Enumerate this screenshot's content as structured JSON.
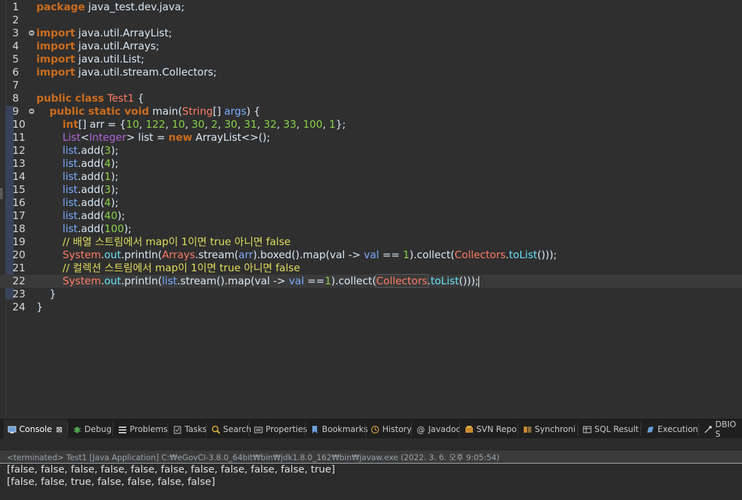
{
  "editor": {
    "lines": [
      {
        "n": "1",
        "html": "<span class=\"kw\">package</span> java_test.dev.java;"
      },
      {
        "n": "2",
        "html": ""
      },
      {
        "n": "3",
        "fold": true,
        "html": "<span class=\"kw\">import</span> java.util.ArrayList;"
      },
      {
        "n": "4",
        "html": "<span class=\"kw\">import</span> java.util.Arrays;"
      },
      {
        "n": "5",
        "html": "<span class=\"kw\">import</span> java.util.List;"
      },
      {
        "n": "6",
        "html": "<span class=\"kw\">import</span> java.util.stream.Collectors;"
      },
      {
        "n": "7",
        "html": ""
      },
      {
        "n": "8",
        "html": "<span class=\"kw\">public class</span> <span class=\"cls\">Test1</span> {"
      },
      {
        "n": "9",
        "fold": true,
        "html": "    <span class=\"kw\">public static void</span> main(<span class=\"cls\">String</span>[] <span class=\"var\">args</span>) {"
      },
      {
        "n": "10",
        "html": "        <span class=\"kw\">int</span>[] arr = {<span class=\"green\">10</span>, <span class=\"green\">122</span>, <span class=\"green\">10</span>, <span class=\"green\">30</span>, <span class=\"green\">2</span>, <span class=\"green\">30</span>, <span class=\"green\">31</span>, <span class=\"green\">32</span>, <span class=\"green\">33</span>, <span class=\"green\">100</span>, <span class=\"green\">1</span>};"
      },
      {
        "n": "11",
        "html": "        <span class=\"type\">List</span>&lt;<span class=\"type\">Integer</span>&gt; list = <span class=\"kw\">new</span> ArrayList&lt;&gt;();"
      },
      {
        "n": "12",
        "html": "        <span class=\"var\">list</span>.add(<span class=\"green\">3</span>);"
      },
      {
        "n": "13",
        "html": "        <span class=\"var\">list</span>.add(<span class=\"green\">4</span>);"
      },
      {
        "n": "14",
        "html": "        <span class=\"var\">list</span>.add(<span class=\"green\">1</span>);"
      },
      {
        "n": "15",
        "html": "        <span class=\"var\">list</span>.add(<span class=\"green\">3</span>);"
      },
      {
        "n": "16",
        "html": "        <span class=\"var\">list</span>.add(<span class=\"green\">4</span>);"
      },
      {
        "n": "17",
        "html": "        <span class=\"var\">list</span>.add(<span class=\"green\">40</span>);"
      },
      {
        "n": "18",
        "html": "        <span class=\"var\">list</span>.add(<span class=\"green\">100</span>);"
      },
      {
        "n": "19",
        "html": "        <span class=\"cmt\">// 배열 스트림에서 map이 1이면 true 아니면 false</span>"
      },
      {
        "n": "20",
        "html": "        <span class=\"cls\">System</span>.<span class=\"field\">out</span>.println(<span class=\"cls\">Arrays</span>.stream(<span class=\"var\">arr</span>).boxed().map(val -&gt; <span class=\"var\">val</span> == <span class=\"green\">1</span>).collect(<span class=\"cls\">Collectors</span>.<span class=\"field\">toList</span>()));"
      },
      {
        "n": "21",
        "html": "        <span class=\"cmt\">// 컬렉션 스트림에서 map이 1이면 true 아니면 false</span>"
      },
      {
        "n": "22",
        "current": true,
        "html": "        <span class=\"cls\">System</span>.<span class=\"field\">out</span>.println(<span class=\"var\">list</span>.stream().map(val -&gt; <span class=\"var\">val</span> ==<span class=\"green\">1</span>).collect(<span class=\"boxhl\"><span class=\"cls\">Collectors</span></span>.<span class=\"field\">toList</span>()));<span id=\"caret\"></span>"
      },
      {
        "n": "23",
        "html": "    }"
      },
      {
        "n": "24",
        "html": "}"
      }
    ]
  },
  "tabs": [
    {
      "label": "Console",
      "icon": "console-icon",
      "active": true,
      "close": "⊠"
    },
    {
      "label": "Debug",
      "icon": "bug-icon"
    },
    {
      "label": "Problems",
      "icon": "problems-icon"
    },
    {
      "label": "Tasks",
      "icon": "tasks-icon"
    },
    {
      "label": "Search",
      "icon": "search-icon"
    },
    {
      "label": "Properties",
      "icon": "properties-icon"
    },
    {
      "label": "Bookmarks",
      "icon": "bookmark-icon"
    },
    {
      "label": "History",
      "icon": "history-icon"
    },
    {
      "label": "Javadoc",
      "icon": "at-icon"
    },
    {
      "label": "SVN Repo",
      "icon": "svn-icon"
    },
    {
      "label": "Synchroni",
      "icon": "sync-icon"
    },
    {
      "label": "SQL Result",
      "icon": "sql-result-icon"
    },
    {
      "label": "Execution",
      "icon": "execution-icon"
    },
    {
      "label": "DBIO S",
      "icon": "dbio-icon"
    }
  ],
  "console": {
    "terminated": "<terminated> Test1 [Java Application] C:₩eGovCI-3.8.0_64bit₩bin₩jdk1.8.0_162₩bin₩javaw.exe (2022. 3. 6. 오후 9:05:54)",
    "output": [
      "[false, false, false, false, false, false, false, false, false, false, true]",
      "[false, false, true, false, false, false, false]"
    ]
  }
}
